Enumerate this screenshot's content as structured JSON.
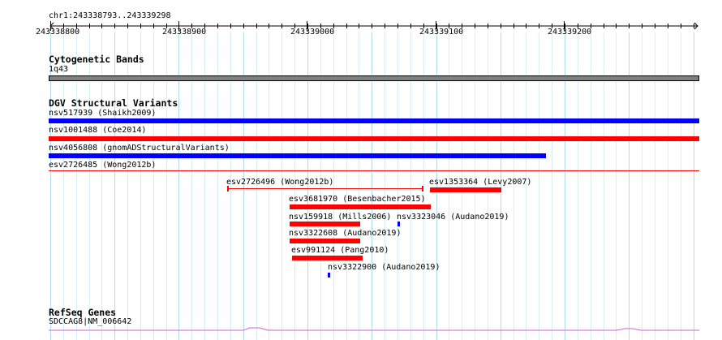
{
  "ruler": {
    "range_label": "chr1:243338793..243339298",
    "ticks": [
      "243338800",
      "243338900",
      "243339000",
      "243339100",
      "243339200"
    ]
  },
  "cytoband": {
    "title": "Cytogenetic Bands",
    "band_label": "1q43",
    "color": "#808080"
  },
  "dgv": {
    "title": "DGV Structural Variants",
    "colors": {
      "loss": "#ff0000",
      "gain": "#0000ff"
    },
    "features": [
      {
        "label": "nsv517939 (Shaikh2009)",
        "color": "#0000ff"
      },
      {
        "label": "nsv1001488 (Coe2014)",
        "color": "#ff0000"
      },
      {
        "label": "nsv4056808 (gnomADStructuralVariants)",
        "color": "#0000ff"
      },
      {
        "label": "esv2726485 (Wong2012b)",
        "color": "#ff0000"
      },
      {
        "label": "esv2726496 (Wong2012b)",
        "color": "#ff0000"
      },
      {
        "label": "esv1353364 (Levy2007)",
        "color": "#ff0000"
      },
      {
        "label": "esv3681970 (Besenbacher2015)",
        "color": "#ff0000"
      },
      {
        "label": "nsv159918 (Mills2006)",
        "color": "#ff0000"
      },
      {
        "label": "nsv3323046 (Audano2019)",
        "color": "#0000ff"
      },
      {
        "label": "nsv3322608 (Audano2019)",
        "color": "#ff0000"
      },
      {
        "label": "esv991124 (Pang2010)",
        "color": "#ff0000"
      },
      {
        "label": "nsv3322900 (Audano2019)",
        "color": "#0000ff"
      }
    ]
  },
  "refseq": {
    "title": "RefSeq Genes",
    "gene_label": "SDCCAG8|NM_006642",
    "color": "#cc66cc"
  }
}
